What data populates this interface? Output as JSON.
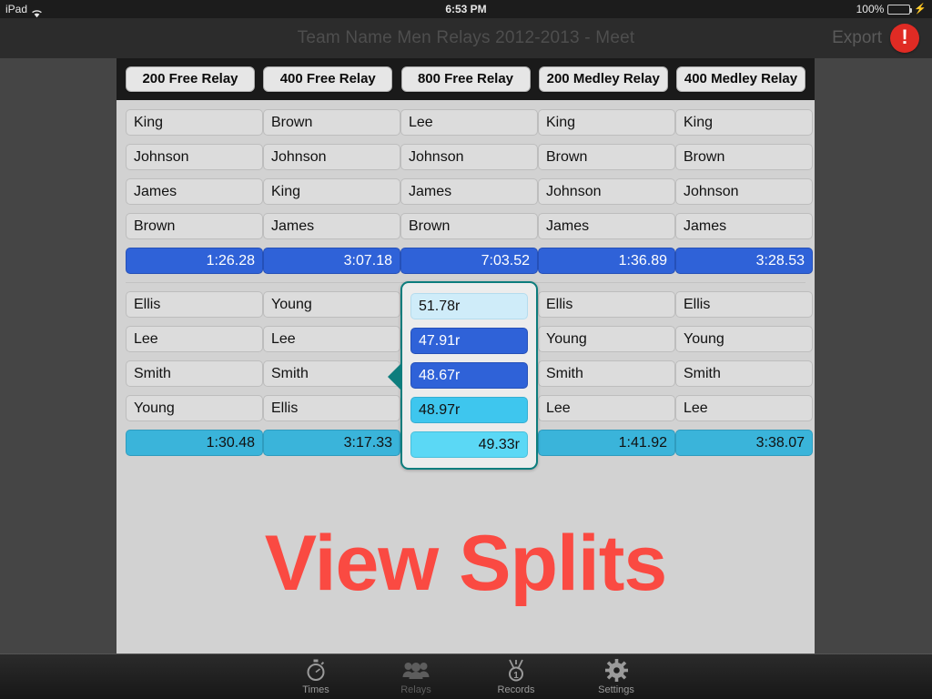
{
  "status_bar": {
    "device": "iPad",
    "wifi_icon": "wifi-icon",
    "time": "6:53 PM",
    "battery_percent": "100%",
    "battery_icon": "battery-icon",
    "charging_icon": "lightning-bolt-icon"
  },
  "nav_bar": {
    "title": "Team Name Men Relays  2012-2013  -  Meet",
    "export_label": "Export",
    "warning_icon": "exclamation-badge-icon",
    "warning_glyph": "!"
  },
  "relay_tabs": [
    {
      "label": "200 Free Relay"
    },
    {
      "label": "400 Free Relay"
    },
    {
      "label": "800 Free Relay"
    },
    {
      "label": "200 Medley Relay"
    },
    {
      "label": "400 Medley Relay"
    }
  ],
  "relay_a": {
    "columns": [
      {
        "swimmers": [
          "King",
          "Johnson",
          "James",
          "Brown"
        ],
        "total": "1:26.28"
      },
      {
        "swimmers": [
          "Brown",
          "Johnson",
          "King",
          "James"
        ],
        "total": "3:07.18"
      },
      {
        "swimmers": [
          "Lee",
          "Johnson",
          "James",
          "Brown"
        ],
        "total": "7:03.52"
      },
      {
        "swimmers": [
          "King",
          "Brown",
          "Johnson",
          "James"
        ],
        "total": "1:36.89"
      },
      {
        "swimmers": [
          "King",
          "Brown",
          "Johnson",
          "James"
        ],
        "total": "3:28.53"
      }
    ]
  },
  "relay_b": {
    "columns": [
      {
        "swimmers": [
          "Ellis",
          "Lee",
          "Smith",
          "Young"
        ],
        "total": "1:30.48"
      },
      {
        "swimmers": [
          "Young",
          "Lee",
          "Smith",
          "Ellis"
        ],
        "total": "3:17.33"
      },
      {
        "swimmers": [
          "Ellis",
          "Young",
          "Smith",
          "Lee"
        ],
        "total": "1:41.92"
      },
      {
        "swimmers": [
          "Ellis",
          "Young",
          "Smith",
          "Lee"
        ],
        "total": "3:38.07"
      }
    ],
    "highlighted_splits": {
      "pointer_icon": "left-arrow-pointer-icon",
      "cells": [
        {
          "value": "51.78r"
        },
        {
          "value": "47.91r"
        },
        {
          "value": "48.67r"
        },
        {
          "value": "48.97r"
        },
        {
          "value": "49.33r"
        }
      ]
    }
  },
  "overlay": {
    "text": "View Splits",
    "color": "#fa4a42"
  },
  "tab_bar": {
    "items": [
      {
        "label": "Times",
        "icon": "stopwatch-icon"
      },
      {
        "label": "Relays",
        "icon": "people-icon"
      },
      {
        "label": "Records",
        "icon": "medal-icon"
      },
      {
        "label": "Settings",
        "icon": "gear-icon"
      }
    ]
  },
  "colors": {
    "total_blue": "#2f62d8",
    "total_cyan": "#3ab4da",
    "highlight_border": "#0d7d7d",
    "warning_red": "#e02b24",
    "battery_green": "#4cd762"
  }
}
